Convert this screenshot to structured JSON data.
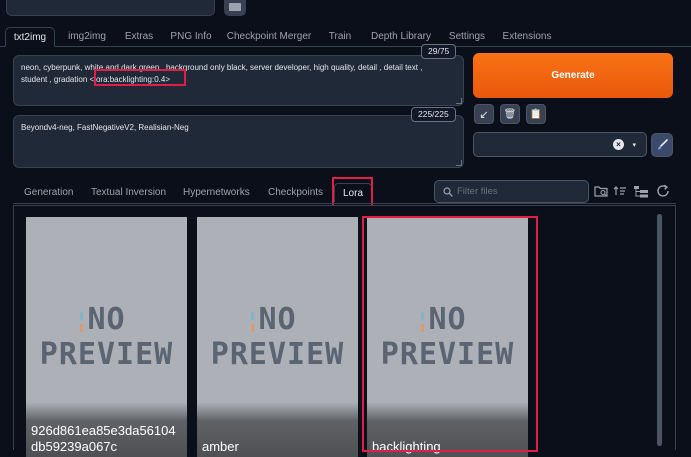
{
  "main_tabs": [
    {
      "label": "txt2img",
      "active": true
    },
    {
      "label": "img2img"
    },
    {
      "label": "Extras"
    },
    {
      "label": "PNG Info"
    },
    {
      "label": "Checkpoint Merger"
    },
    {
      "label": "Train"
    },
    {
      "label": "Depth Library"
    },
    {
      "label": "Settings"
    },
    {
      "label": "Extensions"
    }
  ],
  "positive_prompt": {
    "text_line1": "neon, cyberpunk, white and dark green , background only black, server developer, high quality, detail , detail text ,",
    "text_line2": "student , gradation ",
    "lora_tag": "<lora:backlighting:0.4>",
    "token_count": "29/75"
  },
  "negative_prompt": {
    "text": "Beyondv4-neg, FastNegativeV2, Realisian-Neg",
    "token_count": "225/225"
  },
  "generate_label": "Generate",
  "tools": {
    "arrow_icon": "↙",
    "trash_icon": "🗑",
    "clipboard_icon": "📋"
  },
  "style_select": {
    "clear_icon": "×",
    "caret_icon": "▾"
  },
  "network_tabs": [
    {
      "label": "Generation"
    },
    {
      "label": "Textual Inversion"
    },
    {
      "label": "Hypernetworks"
    },
    {
      "label": "Checkpoints"
    },
    {
      "label": "Lora",
      "active": true
    }
  ],
  "filter": {
    "placeholder": "Filter files"
  },
  "cards": [
    {
      "name": "926d861ea85e3da56104db59239a067c",
      "preview_top": "NO",
      "preview_bottom": "PREVIEW"
    },
    {
      "name": "amber",
      "preview_top": "NO",
      "preview_bottom": "PREVIEW"
    },
    {
      "name": "backlighting",
      "preview_top": "NO",
      "preview_bottom": "PREVIEW",
      "highlighted": true
    }
  ],
  "colors": {
    "accent": "#f97316",
    "highlight": "#e11d48",
    "background": "#0b0f19"
  }
}
